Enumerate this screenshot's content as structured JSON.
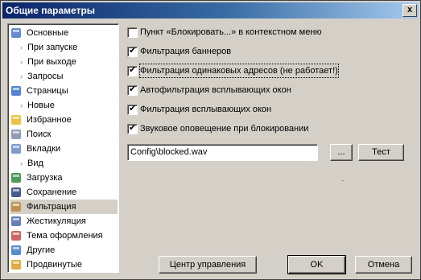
{
  "window": {
    "title": "Общие параметры",
    "close_glyph": "x"
  },
  "sidebar": {
    "items": [
      {
        "label": "Основные",
        "icon": "checklist-icon",
        "color": "#4a78c8",
        "child": false,
        "selected": false
      },
      {
        "label": "При запуске",
        "child": true
      },
      {
        "label": "При выходе",
        "child": true
      },
      {
        "label": "Запросы",
        "child": true
      },
      {
        "label": "Страницы",
        "icon": "window-icon",
        "color": "#3a6fc8",
        "child": false
      },
      {
        "label": "Новые",
        "child": true
      },
      {
        "label": "Избранное",
        "icon": "star-icon",
        "color": "#e8b820",
        "child": false
      },
      {
        "label": "Поиск",
        "icon": "magnifier-icon",
        "color": "#7a8aa8",
        "child": false
      },
      {
        "label": "Вкладки",
        "icon": "tabs-icon",
        "color": "#6a8ac8",
        "child": false
      },
      {
        "label": "Вид",
        "child": true
      },
      {
        "label": "Загрузка",
        "icon": "globe-icon",
        "color": "#2f8a3a",
        "child": false
      },
      {
        "label": "Сохранение",
        "icon": "floppy-icon",
        "color": "#2a3f78",
        "child": false
      },
      {
        "label": "Фильтрация",
        "icon": "broom-icon",
        "color": "#b88a3a",
        "child": false,
        "selected": true
      },
      {
        "label": "Жестикуляция",
        "icon": "pointer-icon",
        "color": "#4a6aa8",
        "child": false
      },
      {
        "label": "Тема оформления",
        "icon": "palette-icon",
        "color": "#c84a4a",
        "child": false
      },
      {
        "label": "Другие",
        "icon": "blocks-icon",
        "color": "#3a78c8",
        "child": false
      },
      {
        "label": "Продвинутые",
        "icon": "gears-icon",
        "color": "#d8a020",
        "child": false
      }
    ]
  },
  "options": [
    {
      "label": "Пункт «Блокировать...» в контекстном меню",
      "checked": false
    },
    {
      "label": "Фильтрация баннеров",
      "checked": true
    },
    {
      "label": "Фильтрация одинаковых адресов (не работает!)",
      "checked": true,
      "focused": true
    },
    {
      "label": "Автофильтрация всплывающих окон",
      "checked": true
    },
    {
      "label": "Фильтрация всплывающих окон",
      "checked": true
    },
    {
      "label": "Звуковое оповещение при блокировании",
      "checked": true
    }
  ],
  "sound": {
    "path": "Config\\blocked.wav",
    "browse_label": "...",
    "test_label": "Тест"
  },
  "footer": {
    "control_center_label": "Центр управления",
    "ok_label": "OK",
    "cancel_label": "Отмена"
  },
  "check_glyph": "✔"
}
